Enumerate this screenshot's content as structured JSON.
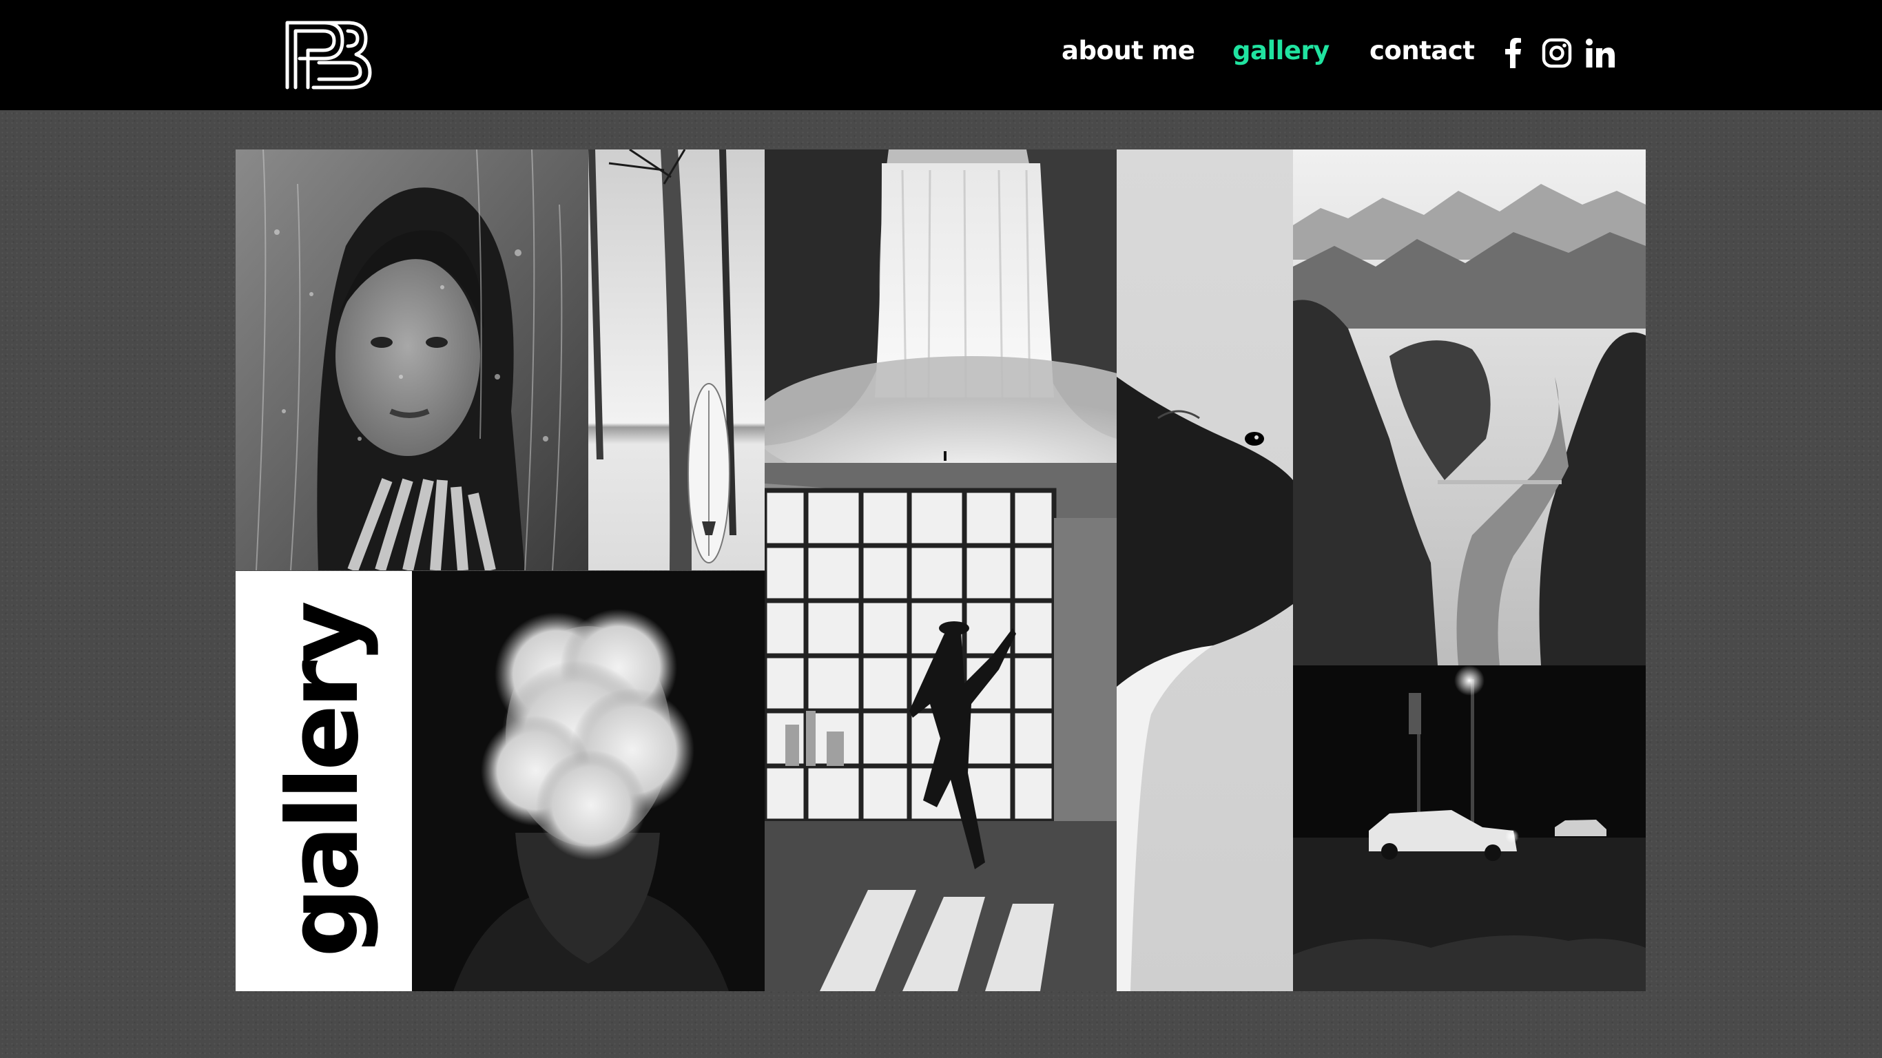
{
  "header": {
    "logo_alt": "PB",
    "nav": {
      "about": "about me",
      "gallery": "gallery",
      "contact": "contact"
    },
    "active_nav": "gallery",
    "social_icons": [
      "facebook-icon",
      "instagram-icon",
      "linkedin-icon"
    ]
  },
  "gallery": {
    "title": "gallery",
    "photos": [
      "portrait-behind-wet-glass",
      "palm-tree-with-surfboard",
      "waterfall",
      "dancer-by-window",
      "dog-looking-up",
      "river-valley-mountains",
      "man-with-smoke-face",
      "car-at-night"
    ]
  },
  "colors": {
    "header_bg": "#000000",
    "page_bg": "#4a4a4a",
    "accent": "#20e3a0",
    "nav_text": "#ffffff",
    "title_panel_bg": "#ffffff",
    "title_text": "#000000"
  }
}
